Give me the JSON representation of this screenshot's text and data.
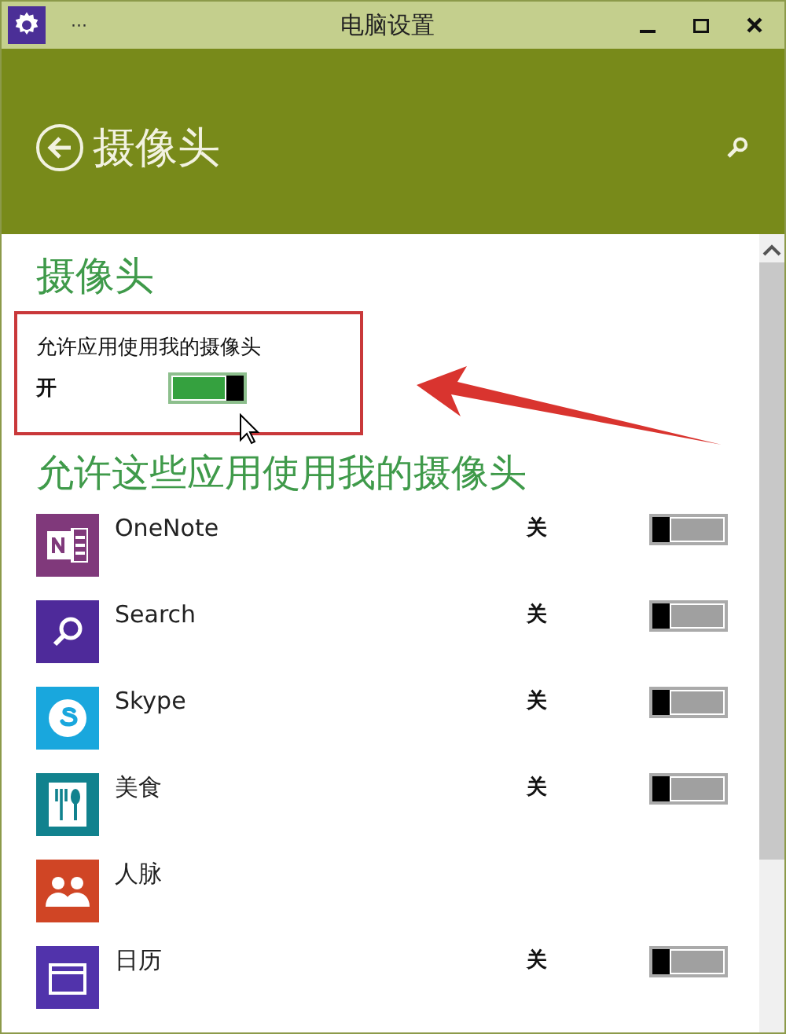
{
  "window": {
    "title": "电脑设置",
    "menu": "···"
  },
  "header": {
    "title": "摄像头"
  },
  "section": {
    "title": "摄像头",
    "setting": {
      "label": "允许应用使用我的摄像头",
      "state": "开",
      "on": true
    }
  },
  "apps_heading": "允许这些应用使用我的摄像头",
  "apps": [
    {
      "name": "OneNote",
      "kind": "onenote",
      "color": "#80397b",
      "state": "关",
      "on": false
    },
    {
      "name": "Search",
      "kind": "search",
      "color": "#4e2a9a",
      "state": "关",
      "on": false
    },
    {
      "name": "Skype",
      "kind": "skype",
      "color": "#19a7dd",
      "state": "关",
      "on": false
    },
    {
      "name": "美食",
      "kind": "food",
      "color": "#11828e",
      "state": "关",
      "on": false
    },
    {
      "name": "人脉",
      "kind": "people",
      "color": "#d04525"
    },
    {
      "name": "日历",
      "kind": "calendar",
      "color": "#5133ab",
      "state": "关",
      "on": false
    }
  ]
}
